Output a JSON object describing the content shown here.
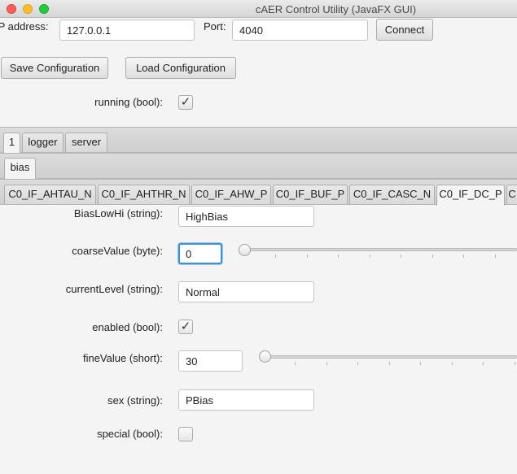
{
  "window": {
    "title": "cAER Control Utility (JavaFX GUI)"
  },
  "connection": {
    "ip_label": "IP address:",
    "ip_value": "127.0.0.1",
    "port_label": "Port:",
    "port_value": "4040",
    "connect_label": "Connect"
  },
  "config": {
    "save_label": "Save Configuration",
    "load_label": "Load Configuration"
  },
  "running": {
    "label": "running (bool):",
    "checked": true,
    "mark": "✓"
  },
  "top_tabs": [
    "1",
    "logger",
    "server"
  ],
  "sub_tabs": [
    "bias"
  ],
  "bias_tabs": [
    "C0_IF_AHTAU_N",
    "C0_IF_AHTHR_N",
    "C0_IF_AHW_P",
    "C0_IF_BUF_P",
    "C0_IF_CASC_N",
    "C0_IF_DC_P",
    "C"
  ],
  "selected_bias_tab": 5,
  "params": {
    "bias_low_hi": {
      "label": "BiasLowHi (string):",
      "value": "HighBias"
    },
    "coarse_value": {
      "label": "coarseValue (byte):",
      "value": "0"
    },
    "current_level": {
      "label": "currentLevel (string):",
      "value": "Normal"
    },
    "enabled": {
      "label": "enabled (bool):",
      "checked": true,
      "mark": "✓"
    },
    "fine_value": {
      "label": "fineValue (short):",
      "value": "30"
    },
    "sex": {
      "label": "sex (string):",
      "value": "PBias"
    },
    "special": {
      "label": "special (bool):",
      "checked": false,
      "mark": ""
    }
  },
  "colors": {
    "focus": "#3e8fdc",
    "close": "#fc5f57",
    "minimize": "#fdbc2e",
    "maximize": "#28c840"
  }
}
